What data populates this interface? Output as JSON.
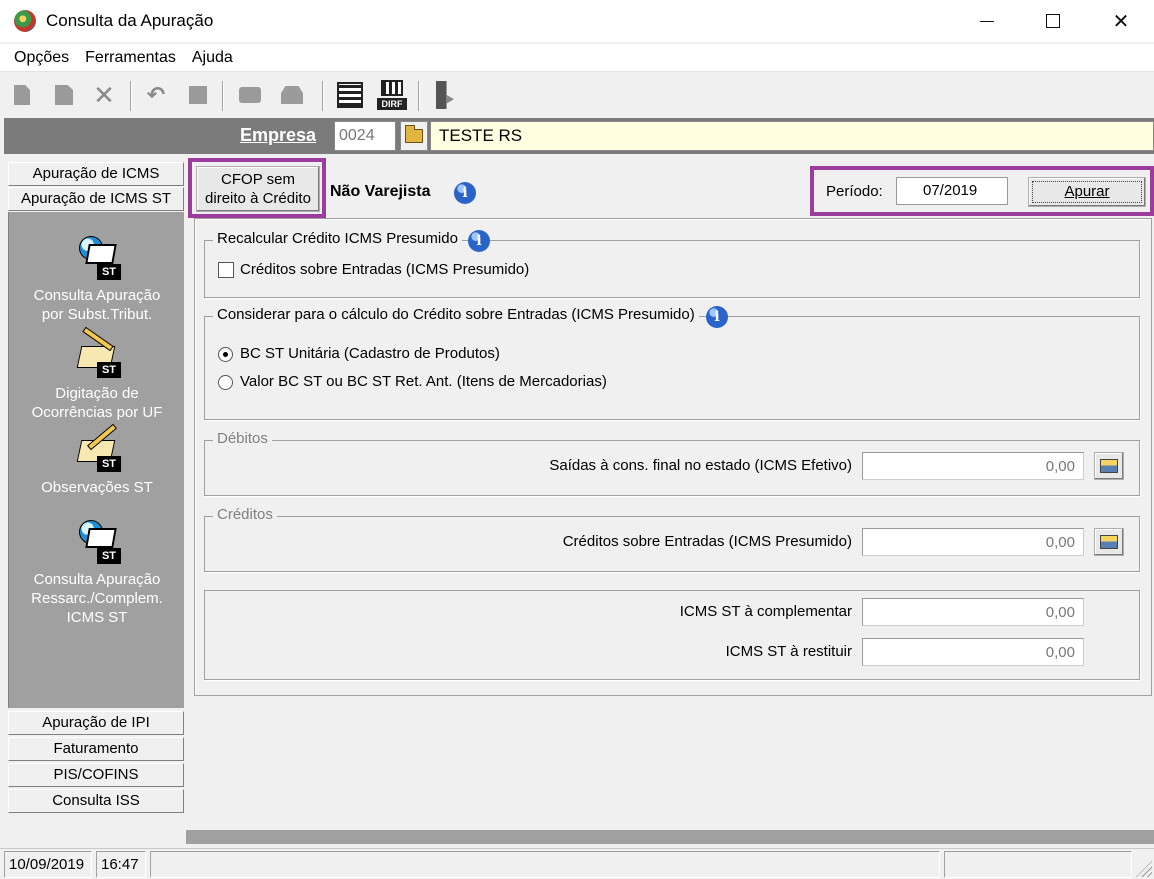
{
  "window": {
    "title": "Consulta da Apuração"
  },
  "menu": [
    "Opções",
    "Ferramentas",
    "Ajuda"
  ],
  "toolbar": {
    "dirf_label": "DIRF"
  },
  "empresa": {
    "label": "Empresa",
    "code": "0024",
    "name": "TESTE RS"
  },
  "left_nav": {
    "top_tabs": [
      "Apuração de ICMS",
      "Apuração de ICMS ST"
    ],
    "panel_items": [
      {
        "icon": "consulta-apuracao-icon",
        "label_lines": [
          "Consulta  Apuração",
          "por Subst.Tribut."
        ]
      },
      {
        "icon": "digitacao-ocorrencias-icon",
        "label_lines": [
          "Digitação de",
          "Ocorrências por UF"
        ]
      },
      {
        "icon": "observacoes-icon",
        "label_lines": [
          "Observações ST"
        ]
      },
      {
        "icon": "consulta-ressarc-icon",
        "label_lines": [
          "Consulta Apuração",
          "Ressarc./Complem.",
          "ICMS ST"
        ]
      }
    ],
    "icon_badge": "ST",
    "bottom_tabs": [
      "Apuração de IPI",
      "Faturamento",
      "PIS/COFINS",
      "Consulta ISS"
    ]
  },
  "header": {
    "cfop_button_lines": [
      "CFOP sem",
      "direito à Crédito"
    ],
    "nao_varejista": "Não Varejista",
    "periodo_label": "Período:",
    "periodo_value": "07/2019",
    "apurar_label": "Apurar",
    "info_glyph": "i"
  },
  "recalcular": {
    "title": "Recalcular Crédito ICMS Presumido",
    "checkbox_label": "Créditos sobre Entradas (ICMS Presumido)",
    "checked": false
  },
  "considerar": {
    "title": "Considerar para o cálculo do Crédito sobre Entradas (ICMS Presumido)",
    "options": [
      "BC ST Unitária (Cadastro de Produtos)",
      "Valor BC ST ou BC ST Ret. Ant. (Itens de Mercadorias)"
    ],
    "selected": 0
  },
  "debitos": {
    "title": "Débitos",
    "field_label": "Saídas à cons. final no estado (ICMS Efetivo)",
    "value": "0,00"
  },
  "creditos": {
    "title": "Créditos",
    "field_label": "Créditos sobre Entradas (ICMS Presumido)",
    "value": "0,00"
  },
  "totais": {
    "complementar_label": "ICMS ST à complementar",
    "complementar_value": "0,00",
    "restituir_label": "ICMS ST à restituir",
    "restituir_value": "0,00"
  },
  "status": {
    "date": "10/09/2019",
    "time": "16:47"
  },
  "colors": {
    "highlight": "#9c3d9c",
    "empresa_band": "#7b7b7b",
    "empresa_name_bg": "#ffffe1",
    "nav_panel": "#a0a0a0"
  }
}
